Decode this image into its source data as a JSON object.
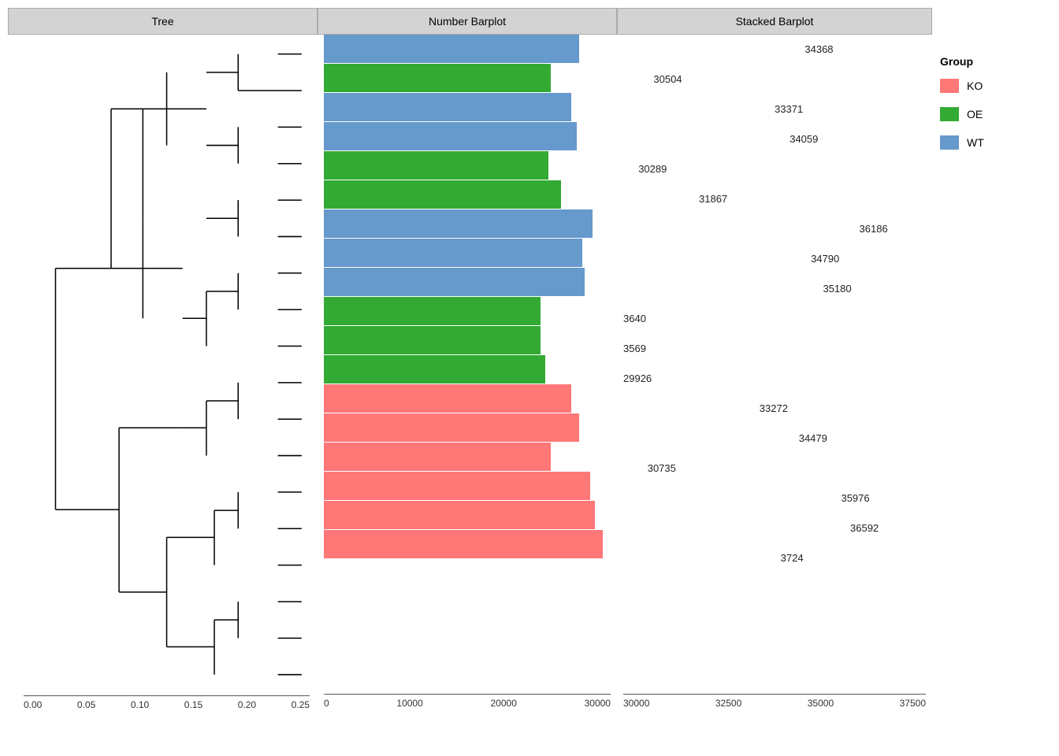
{
  "panels": {
    "tree": {
      "title": "Tree",
      "axis_labels": [
        "0.00",
        "0.05",
        "0.10",
        "0.15",
        "0.20",
        "0.25"
      ]
    },
    "barplot": {
      "title": "Number Barplot",
      "axis_labels": [
        "0",
        "10000",
        "20000",
        "30000"
      ],
      "bars": [
        {
          "color": "blue",
          "value": 34368,
          "pct": 98
        },
        {
          "color": "green",
          "value": 30504,
          "pct": 87
        },
        {
          "color": "blue",
          "value": 33371,
          "pct": 95
        },
        {
          "color": "blue",
          "value": 34059,
          "pct": 97
        },
        {
          "color": "green",
          "value": 30289,
          "pct": 86
        },
        {
          "color": "green",
          "value": 31867,
          "pct": 91
        },
        {
          "color": "blue",
          "value": 36186,
          "pct": 103
        },
        {
          "color": "blue",
          "value": 34790,
          "pct": 99
        },
        {
          "color": "blue",
          "value": 35180,
          "pct": 100
        },
        {
          "color": "green",
          "value": 3640,
          "pct": 83
        },
        {
          "color": "green",
          "value": 3569,
          "pct": 83
        },
        {
          "color": "green",
          "value": 29926,
          "pct": 85
        },
        {
          "color": "red",
          "value": 33272,
          "pct": 95
        },
        {
          "color": "red",
          "value": 34479,
          "pct": 98
        },
        {
          "color": "red",
          "value": 30735,
          "pct": 87
        },
        {
          "color": "red",
          "value": 35976,
          "pct": 102
        },
        {
          "color": "red",
          "value": 36592,
          "pct": 104
        },
        {
          "color": "red",
          "value": 3724,
          "pct": 107
        }
      ]
    },
    "stacked": {
      "title": "Stacked Barplot",
      "axis_labels": [
        "30000",
        "32500",
        "35000",
        "37500"
      ],
      "labels": [
        {
          "text": "34368",
          "offset_pct": 60
        },
        {
          "text": "30504",
          "offset_pct": 10
        },
        {
          "text": "33371",
          "offset_pct": 50
        },
        {
          "text": "34059",
          "offset_pct": 55
        },
        {
          "text": "30289",
          "offset_pct": 5
        },
        {
          "text": "31867",
          "offset_pct": 25
        },
        {
          "text": "36186",
          "offset_pct": 78
        },
        {
          "text": "34790",
          "offset_pct": 62
        },
        {
          "text": "35180",
          "offset_pct": 66
        },
        {
          "text": "3640",
          "offset_pct": 0
        },
        {
          "text": "3569",
          "offset_pct": 0
        },
        {
          "text": "29926",
          "offset_pct": 0
        },
        {
          "text": "33272",
          "offset_pct": 45
        },
        {
          "text": "34479",
          "offset_pct": 58
        },
        {
          "text": "30735",
          "offset_pct": 8
        },
        {
          "text": "35976",
          "offset_pct": 72
        },
        {
          "text": "36592",
          "offset_pct": 75
        },
        {
          "text": "3724",
          "offset_pct": 52
        }
      ]
    }
  },
  "legend": {
    "title": "Group",
    "items": [
      {
        "label": "KO",
        "color": "#FF7777"
      },
      {
        "label": "OE",
        "color": "#33AA33"
      },
      {
        "label": "WT",
        "color": "#6699CC"
      }
    ]
  }
}
